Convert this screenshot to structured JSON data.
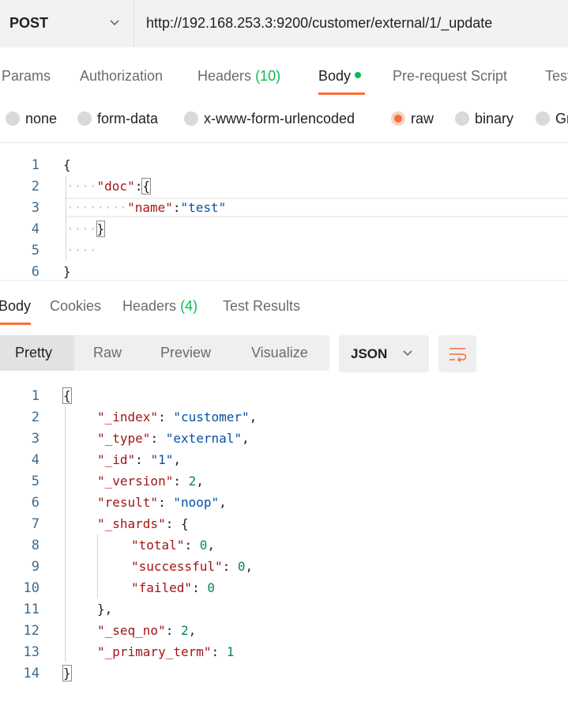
{
  "request": {
    "method": "POST",
    "url": "http://192.168.253.3:9200/customer/external/1/_update"
  },
  "request_tabs": {
    "params": "Params",
    "authorization": "Authorization",
    "headers_label": "Headers",
    "headers_count": "(10)",
    "body": "Body",
    "prerequest": "Pre-request Script",
    "tests": "Tests"
  },
  "body_types": {
    "none": "none",
    "form_data": "form-data",
    "urlencoded": "x-www-form-urlencoded",
    "raw": "raw",
    "binary": "binary",
    "graphql": "GraphQL",
    "selected": "raw"
  },
  "request_body": {
    "line_numbers": [
      "1",
      "2",
      "3",
      "4",
      "5",
      "6"
    ],
    "open_brace": "{",
    "doc_key": "\"doc\"",
    "colon": ":",
    "doc_open": "{",
    "name_key": "\"name\"",
    "name_value": "\"test\"",
    "doc_close": "}",
    "close_brace": "}"
  },
  "response_tabs": {
    "body": "Body",
    "cookies": "Cookies",
    "headers_label": "Headers",
    "headers_count": "(4)",
    "test_results": "Test Results"
  },
  "view_modes": {
    "pretty": "Pretty",
    "raw": "Raw",
    "preview": "Preview",
    "visualize": "Visualize",
    "selected": "Pretty"
  },
  "format": "JSON",
  "response_body": {
    "line_numbers": [
      "1",
      "2",
      "3",
      "4",
      "5",
      "6",
      "7",
      "8",
      "9",
      "10",
      "11",
      "12",
      "13",
      "14"
    ],
    "index_key": "\"_index\"",
    "index_value": "\"customer\"",
    "type_key": "\"_type\"",
    "type_value": "\"external\"",
    "id_key": "\"_id\"",
    "id_value": "\"1\"",
    "version_key": "\"_version\"",
    "version_value": "2",
    "result_key": "\"result\"",
    "result_value": "\"noop\"",
    "shards_key": "\"_shards\"",
    "total_key": "\"total\"",
    "total_value": "0",
    "successful_key": "\"successful\"",
    "successful_value": "0",
    "failed_key": "\"failed\"",
    "failed_value": "0",
    "seq_no_key": "\"_seq_no\"",
    "seq_no_value": "2",
    "primary_term_key": "\"_primary_term\"",
    "primary_term_value": "1"
  },
  "colors": {
    "accent": "#ff6c37",
    "count_green": "#0cbb52",
    "json_key": "#a31515",
    "json_string": "#0451a5",
    "json_number": "#098658"
  },
  "icons": {
    "method_dropdown": "chevron-down-icon",
    "format_dropdown": "chevron-down-icon",
    "wrap": "wrap-lines-icon",
    "body_modified": "dot-indicator-icon"
  }
}
